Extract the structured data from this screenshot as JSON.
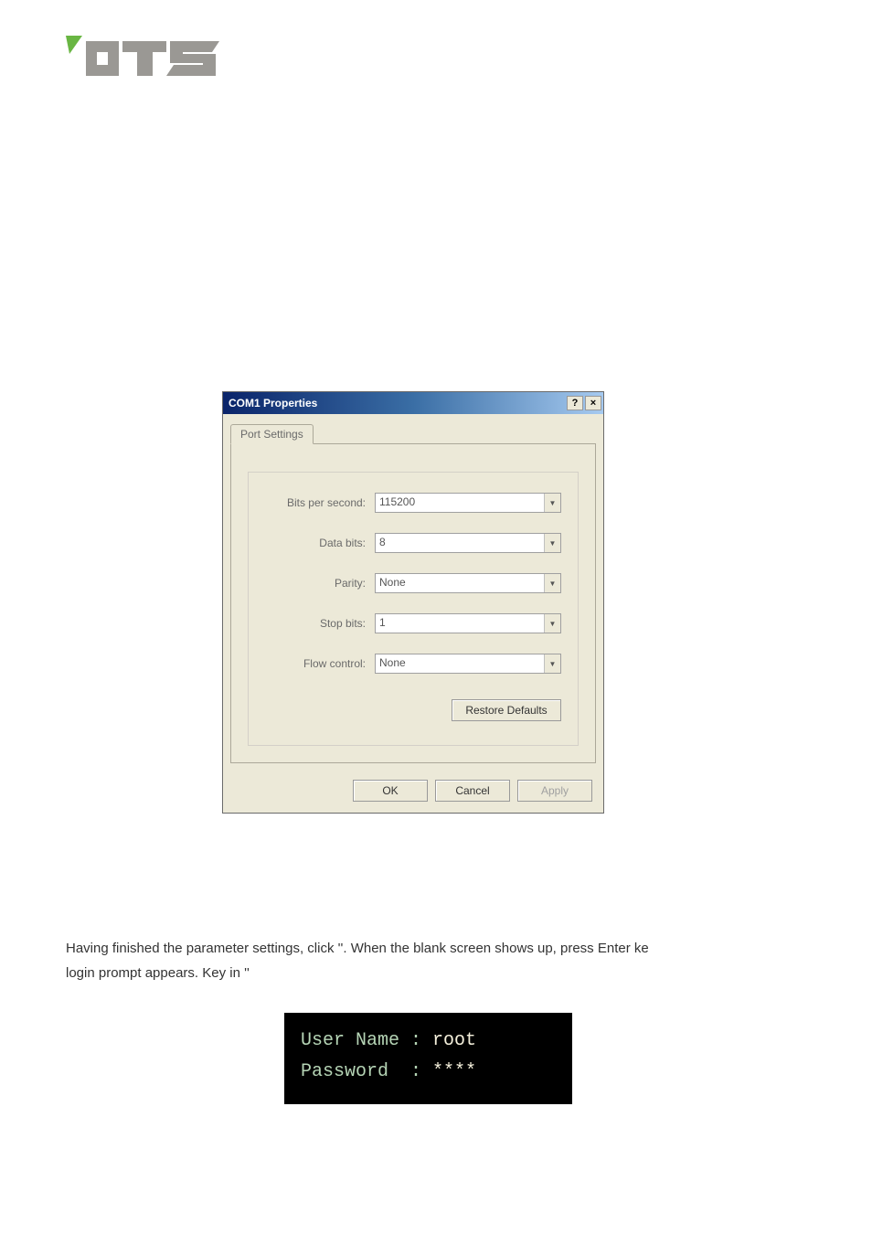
{
  "dialog": {
    "title": "COM1 Properties",
    "help": "?",
    "close": "×",
    "tab": "Port Settings",
    "fields": {
      "bits_per_second": {
        "label": "Bits per second:",
        "value": "115200"
      },
      "data_bits": {
        "label": "Data bits:",
        "value": "8"
      },
      "parity": {
        "label": "Parity:",
        "value": "None"
      },
      "stop_bits": {
        "label": "Stop bits:",
        "value": "1"
      },
      "flow_control": {
        "label": "Flow control:",
        "value": "None"
      }
    },
    "restore": "Restore Defaults",
    "ok": "OK",
    "cancel": "Cancel",
    "apply": "Apply"
  },
  "body": {
    "line1a": "Having finished the parameter settings, click '",
    "line1b": "'. When the blank screen shows up, press Enter ke",
    "line2a": "login prompt appears. Key in '",
    "line2b": "'"
  },
  "terminal": {
    "user_label": "User Name : ",
    "user_value": "root",
    "pass_label": "Password  : ",
    "pass_value": "****"
  }
}
